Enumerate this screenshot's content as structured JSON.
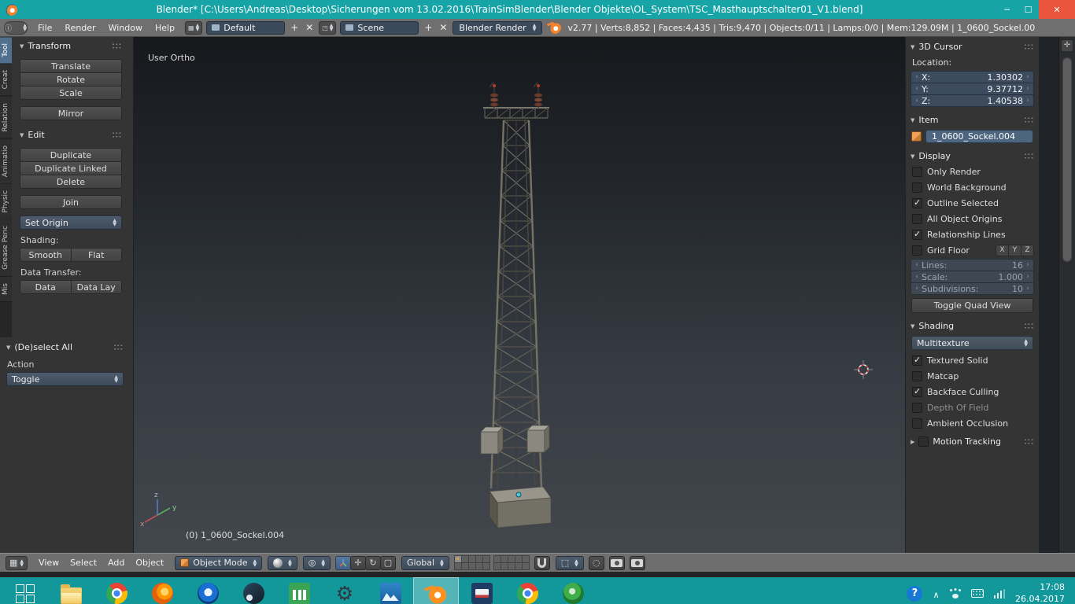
{
  "theme": {
    "titlebar_teal": "#17a4a7",
    "close_red": "#e8543c",
    "field_blue": "#3c4c5e",
    "selection_blue": "#4d657e",
    "blender_orange": "#f5822d",
    "active_tab_blue": "#50708e"
  },
  "window": {
    "title": "Blender* [C:\\Users\\Andreas\\Desktop\\Sicherungen vom 13.02.2016\\TrainSimBlender\\Blender Objekte\\OL_System\\TSC_Masthauptschalter01_V1.blend]",
    "controls": {
      "minimize": "─",
      "maximize": "☐",
      "close": "✕"
    }
  },
  "infobar": {
    "menus": [
      "File",
      "Render",
      "Window",
      "Help"
    ],
    "layout": {
      "value": "Default",
      "add": "+",
      "remove": "✕"
    },
    "scene": {
      "value": "Scene",
      "add": "+",
      "remove": "✕"
    },
    "engine": {
      "value": "Blender Render"
    },
    "stats": "v2.77 | Verts:8,852 | Faces:4,435 | Tris:9,470 | Objects:0/11 | Lamps:0/0 | Mem:129.09M | 1_0600_Sockel.00"
  },
  "toolshelf": {
    "tabs": [
      {
        "label": "Tool",
        "active": true
      },
      {
        "label": "Creat",
        "active": false
      },
      {
        "label": "Relation",
        "active": false
      },
      {
        "label": "Animatio",
        "active": false
      },
      {
        "label": "Physic",
        "active": false
      },
      {
        "label": "Grease Penc",
        "active": false
      },
      {
        "label": "Mis",
        "active": false
      }
    ],
    "panels": {
      "transform": {
        "title": "Transform",
        "group1": [
          "Translate",
          "Rotate",
          "Scale"
        ],
        "mirror": "Mirror"
      },
      "edit": {
        "title": "Edit",
        "group1": [
          "Duplicate",
          "Duplicate Linked",
          "Delete"
        ],
        "join": "Join",
        "set_origin": "Set Origin",
        "shading_label": "Shading:",
        "shading_buttons": [
          "Smooth",
          "Flat"
        ],
        "data_transfer_label": "Data Transfer:",
        "data_buttons": [
          "Data",
          "Data Lay"
        ]
      },
      "deselect": {
        "title": "(De)select All",
        "action_label": "Action",
        "toggle_value": "Toggle"
      }
    }
  },
  "viewport": {
    "view_label": "User Ortho",
    "object_label": "(0) 1_0600_Sockel.004",
    "axes": {
      "x": "x",
      "y": "y",
      "z": "z"
    }
  },
  "sidebar": {
    "cursor": {
      "title": "3D Cursor",
      "location_label": "Location:",
      "fields": [
        {
          "label": "X:",
          "value": "1.30302"
        },
        {
          "label": "Y:",
          "value": "9.37712"
        },
        {
          "label": "Z:",
          "value": "1.40538"
        }
      ]
    },
    "item": {
      "title": "Item",
      "name": "1_0600_Sockel.004"
    },
    "display": {
      "title": "Display",
      "options": [
        {
          "label": "Only Render",
          "checked": false
        },
        {
          "label": "World Background",
          "checked": false
        },
        {
          "label": "Outline Selected",
          "checked": true
        },
        {
          "label": "All Object Origins",
          "checked": false
        },
        {
          "label": "Relationship Lines",
          "checked": true
        }
      ],
      "grid_floor": {
        "label": "Grid Floor",
        "checked": false,
        "axes": [
          "X",
          "Y",
          "Z"
        ]
      },
      "number_fields": [
        {
          "label": "Lines:",
          "value": "16"
        },
        {
          "label": "Scale:",
          "value": "1.000"
        },
        {
          "label": "Subdivisions:",
          "value": "10"
        }
      ],
      "toggle_quad_label": "Toggle Quad View"
    },
    "shading": {
      "title": "Shading",
      "mode": "Multitexture",
      "options": [
        {
          "label": "Textured Solid",
          "checked": true,
          "disabled": false
        },
        {
          "label": "Matcap",
          "checked": false,
          "disabled": false
        },
        {
          "label": "Backface Culling",
          "checked": true,
          "disabled": false
        },
        {
          "label": "Depth Of Field",
          "checked": false,
          "disabled": true
        },
        {
          "label": "Ambient Occlusion",
          "checked": false,
          "disabled": false
        }
      ]
    },
    "motion_tracking": {
      "title": "Motion Tracking",
      "checked": false
    }
  },
  "viewport_header": {
    "menus": [
      "View",
      "Select",
      "Add",
      "Object"
    ],
    "mode": "Object Mode",
    "orientation": "Global",
    "layers": {
      "count": 20,
      "active_index": 0
    }
  },
  "taskbar": {
    "apps": [
      {
        "name": "start",
        "kind": "start",
        "active": false
      },
      {
        "name": "file-explorer",
        "kind": "folder",
        "active": false
      },
      {
        "name": "chrome",
        "kind": "chrome",
        "active": false
      },
      {
        "name": "firefox",
        "kind": "firefox",
        "active": false
      },
      {
        "name": "opera",
        "kind": "opera",
        "active": false
      },
      {
        "name": "steam",
        "kind": "steam",
        "active": false
      },
      {
        "name": "chart-app",
        "kind": "chart",
        "active": false
      },
      {
        "name": "settings",
        "kind": "gear",
        "active": false
      },
      {
        "name": "photos",
        "kind": "photos",
        "active": false
      },
      {
        "name": "blender",
        "kind": "blender",
        "active": true
      },
      {
        "name": "media-app",
        "kind": "shield",
        "active": false
      },
      {
        "name": "chrome-2",
        "kind": "chrome",
        "active": false
      },
      {
        "name": "green-app",
        "kind": "leaf",
        "active": false
      }
    ],
    "tray": {
      "time": "17:08",
      "date": "26.04.2017"
    }
  }
}
